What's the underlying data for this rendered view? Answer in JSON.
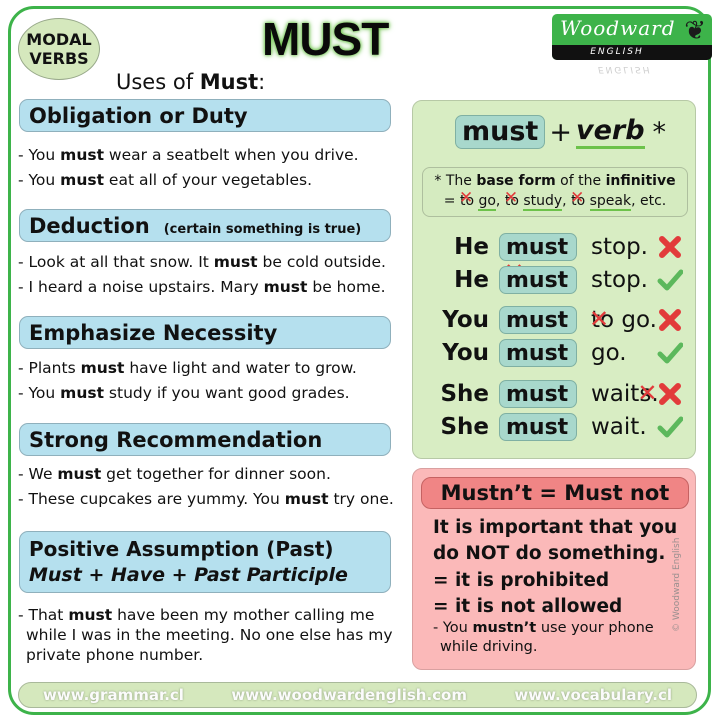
{
  "badge": {
    "line1": "MODAL",
    "line2": "VERBS"
  },
  "title": "MUST",
  "logo": {
    "brand": "Woodward",
    "sub": "ENGLISH",
    "registered": "®"
  },
  "uses_heading": {
    "prefix": "Uses of ",
    "bold": "Must",
    "suffix": ":"
  },
  "sections": [
    {
      "title": "Obligation or Duty",
      "examples": [
        {
          "pre": "- You ",
          "bold": "must",
          "post": " wear a seatbelt when you drive."
        },
        {
          "pre": "- You ",
          "bold": "must",
          "post": " eat all of your vegetables."
        }
      ]
    },
    {
      "title": "Deduction",
      "subtitle": "(certain something is true)",
      "examples": [
        {
          "pre": "- Look at all that snow. It ",
          "bold": "must",
          "post": " be cold outside."
        },
        {
          "pre": "- I heard a noise upstairs. Mary ",
          "bold": "must",
          "post": " be home."
        }
      ]
    },
    {
      "title": "Emphasize Necessity",
      "examples": [
        {
          "pre": "- Plants ",
          "bold": "must",
          "post": " have light and water to grow."
        },
        {
          "pre": "- You ",
          "bold": "must",
          "post": " study if you want good grades."
        }
      ]
    },
    {
      "title": "Strong Recommendation",
      "examples": [
        {
          "pre": "- We ",
          "bold": "must",
          "post": " get together for dinner soon."
        },
        {
          "pre": "- These cupcakes are yummy. You ",
          "bold": "must",
          "post": " try one."
        }
      ]
    },
    {
      "title": "Positive Assumption (Past)",
      "subtitle": "Must + Have + Past Participle",
      "examples": [
        {
          "pre": "- That ",
          "bold": "must",
          "post": " have been my mother calling me while I was in the meeting. No one else has my private phone number."
        }
      ]
    }
  ],
  "formula": {
    "must": "must",
    "plus": "+",
    "verb": "verb",
    "star": "*"
  },
  "note": {
    "line1_pre": "* The ",
    "line1_bold1": "base form",
    "line1_mid": " of the ",
    "line1_bold2": "infinitive",
    "eq": "= ",
    "to": "to",
    "items": [
      "go",
      "study",
      "speak"
    ],
    "etc": ", etc."
  },
  "examples_table": [
    {
      "subject": "He",
      "verb": "must",
      "verb_struck_suffix": "s",
      "rest": "stop.",
      "rest_struck_prefix": "",
      "rest_struck_suffix": "",
      "correct": false
    },
    {
      "subject": "He",
      "verb": "must",
      "verb_struck_suffix": "",
      "rest": "stop.",
      "rest_struck_prefix": "",
      "rest_struck_suffix": "",
      "correct": true
    },
    {
      "subject": "You",
      "verb": "must",
      "verb_struck_suffix": "",
      "rest": " go.",
      "rest_struck_prefix": "to",
      "rest_struck_suffix": "",
      "correct": false
    },
    {
      "subject": "You",
      "verb": "must",
      "verb_struck_suffix": "",
      "rest": "go.",
      "rest_struck_prefix": "",
      "rest_struck_suffix": "",
      "correct": true
    },
    {
      "subject": "She",
      "verb": "must",
      "verb_struck_suffix": "",
      "rest": "wait",
      "rest_struck_prefix": "",
      "rest_struck_suffix": "s",
      "rest_after": ".",
      "correct": false
    },
    {
      "subject": "She",
      "verb": "must",
      "verb_struck_suffix": "",
      "rest": "wait.",
      "rest_struck_prefix": "",
      "rest_struck_suffix": "",
      "correct": true
    }
  ],
  "mustnt": {
    "header": "Mustn’t = Must not",
    "lines": [
      "It is important that you",
      "do NOT do something.",
      "= it is prohibited",
      "= it is not allowed"
    ],
    "example": {
      "pre": "- You ",
      "bold": "mustn’t",
      "post": " use your phone while driving."
    }
  },
  "copyright": "© Woodward English",
  "footer": {
    "links": [
      "www.grammar.cl",
      "www.woodwardenglish.com",
      "www.vocabulary.cl"
    ]
  },
  "colors": {
    "frame": "#3db34a",
    "section_header": "#b5e0ee",
    "green_panel": "#d8edc3",
    "pill": "#a8d8cc",
    "red_panel": "#fbb9b9",
    "red_header": "#f08585",
    "wrong_mark": "#e23b3b",
    "right_mark": "#5cb85c",
    "footer": "#d5e8bd"
  }
}
